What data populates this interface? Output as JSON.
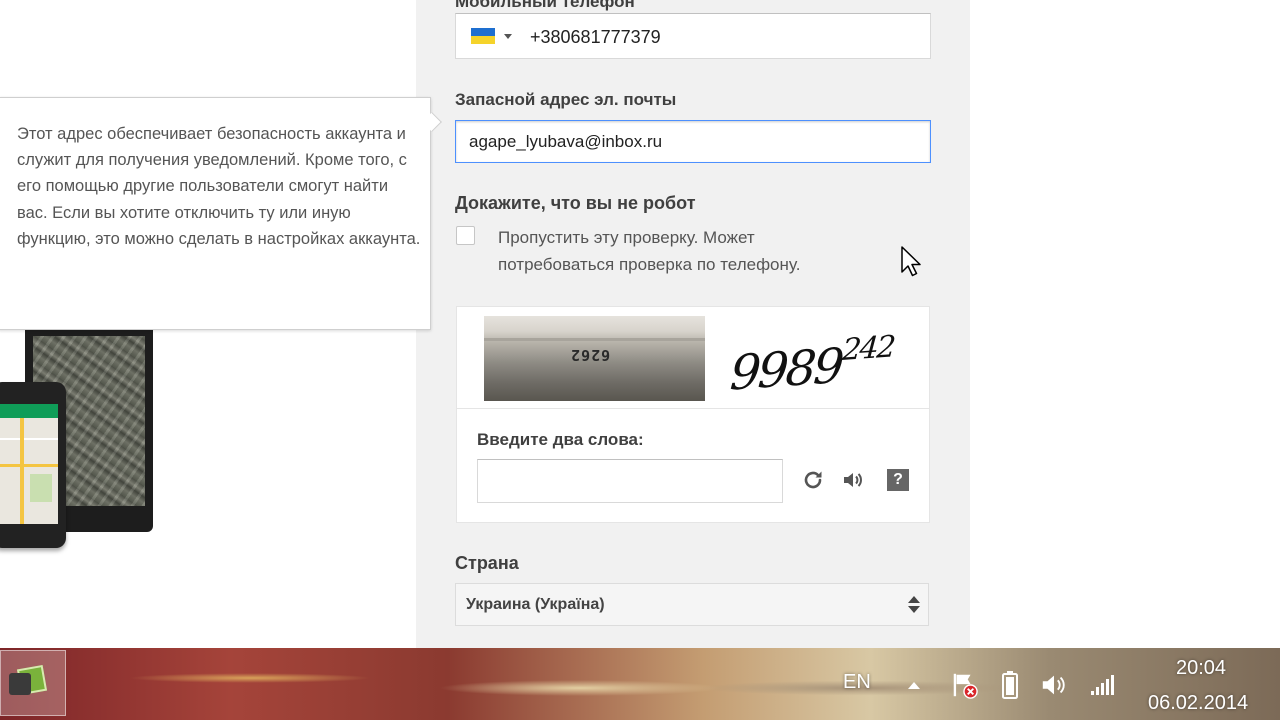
{
  "form": {
    "phone_label_cut": "Мобильный телефон",
    "phone_value": "+380681777379",
    "email_label": "Запасной адрес эл. почты",
    "email_value": "agape_lyubava@inbox.ru",
    "robot_title": "Докажите, что вы не робот",
    "skip_text": "Пропустить эту проверку. Может потребоваться проверка по телефону.",
    "captcha_photo_text": "6262",
    "captcha_word_main": "9989",
    "captcha_word_sup": "242",
    "captcha_prompt": "Введите два слова:",
    "captcha_input_value": "",
    "country_label": "Страна",
    "country_value": "Украина (Україна)"
  },
  "tooltip": {
    "text": "Этот адрес обеспечивает безопасность аккаунта и служит для получения уведомлений. Кроме того, с его помощью другие пользователи смогут найти вас. Если вы хотите отключить ту или иную функцию, это можно сделать в настройках аккаунта."
  },
  "taskbar": {
    "language": "EN",
    "time": "20:04",
    "date": "06.02.2014"
  },
  "icons": {
    "flag": "ukraine-flag-icon",
    "captcha": [
      "refresh-icon",
      "audio-icon",
      "help-icon"
    ],
    "tray": [
      "show-hidden-icons-icon",
      "action-center-flag-icon",
      "battery-icon",
      "volume-icon",
      "network-signal-icon"
    ]
  },
  "colors": {
    "focus_border": "#4d90fe",
    "form_background": "#f1f1f1",
    "flag_blue": "#1e6fd0",
    "flag_yellow": "#f5d32a"
  }
}
